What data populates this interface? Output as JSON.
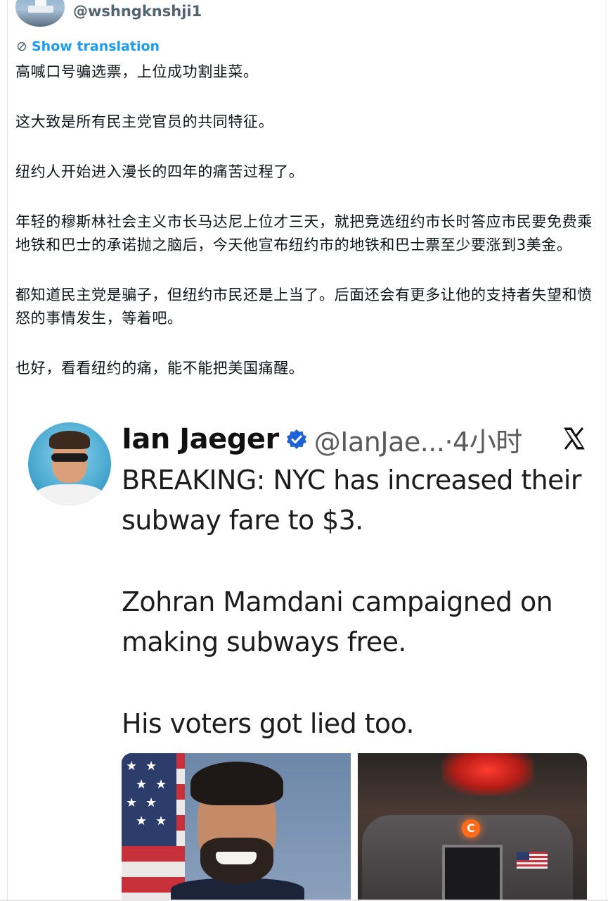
{
  "author": {
    "handle": "@wshngknshji1"
  },
  "translation": {
    "label": "Show translation",
    "icon": "translate-icon"
  },
  "post": {
    "paragraphs": [
      "高喊口号骗选票，上位成功割韭菜。",
      "这大致是所有民主党官员的共同特征。",
      "纽约人开始进入漫长的四年的痛苦过程了。",
      "年轻的穆斯林社会主义市长马达尼上位才三天，就把竞选纽约市长时答应市民要免费乘地铁和巴士的承诺抛之脑后，今天他宣布纽约市的地铁和巴士票至少要涨到3美金。",
      "都知道民主党是骗子，但纽约市民还是上当了。后面还会有更多让他的支持者失望和愤怒的事情发生，等着吧。",
      "也好，看看纽约的痛，能不能把美国痛醒。"
    ]
  },
  "quoted_post": {
    "name": "Ian Jaeger",
    "handle_time": "@IanJae...·4小时",
    "verified_icon": "verified-badge-icon",
    "brand_icon": "x-logo-icon",
    "paragraphs": [
      "BREAKING: NYC has increased their subway fare to $3.",
      "Zohran Mamdani campaigned on making subways free.",
      "His voters got lied too."
    ],
    "media": [
      {
        "name": "politician-photo"
      },
      {
        "name": "subway-train-photo",
        "route_label": "C"
      }
    ]
  },
  "colors": {
    "link": "#1d9bf0",
    "verified": "#1d62d6",
    "text": "#0f1419",
    "muted": "#536471"
  }
}
